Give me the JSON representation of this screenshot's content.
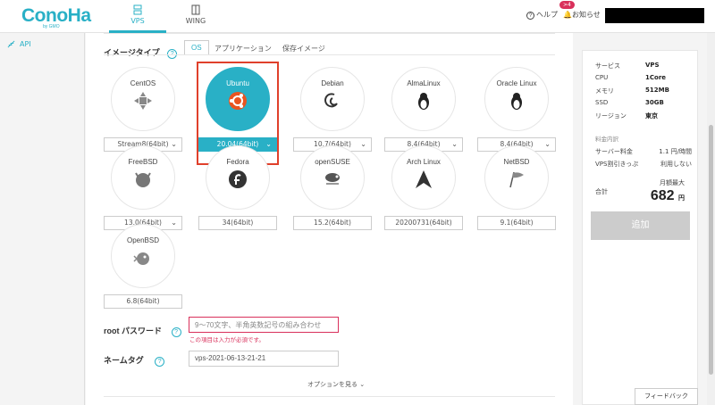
{
  "header": {
    "logo": "ConoHa",
    "logo_sub": "by GMO",
    "tabs": [
      {
        "label": "VPS"
      },
      {
        "label": "WING"
      }
    ],
    "help": "ヘルプ",
    "notice": "お知らせ",
    "notice_badge": ">4"
  },
  "sidebar": {
    "items": [
      {
        "label": "API"
      }
    ]
  },
  "main": {
    "image_type_label": "イメージタイプ",
    "subtabs": [
      {
        "label": "OS"
      },
      {
        "label": "アプリケーション"
      },
      {
        "label": "保存イメージ"
      }
    ],
    "os_list": [
      {
        "name": "CentOS",
        "version": "Stream8(64bit)",
        "has_dropdown": true
      },
      {
        "name": "Ubuntu",
        "version": "20.04(64bit)",
        "has_dropdown": true,
        "selected": true
      },
      {
        "name": "Debian",
        "version": "10.7(64bit)",
        "has_dropdown": true
      },
      {
        "name": "AlmaLinux",
        "version": "8.4(64bit)",
        "has_dropdown": true
      },
      {
        "name": "Oracle Linux",
        "version": "8.4(64bit)",
        "has_dropdown": true
      },
      {
        "name": "FreeBSD",
        "version": "13.0(64bit)",
        "has_dropdown": true
      },
      {
        "name": "Fedora",
        "version": "34(64bit)",
        "has_dropdown": false
      },
      {
        "name": "openSUSE",
        "version": "15.2(64bit)",
        "has_dropdown": false
      },
      {
        "name": "Arch Linux",
        "version": "20200731(64bit)",
        "has_dropdown": false
      },
      {
        "name": "NetBSD",
        "version": "9.1(64bit)",
        "has_dropdown": false
      },
      {
        "name": "OpenBSD",
        "version": "6.8(64bit)",
        "has_dropdown": false
      }
    ],
    "root_password_label": "root パスワード",
    "root_password_placeholder": "9～70文字、半角英数記号の組み合わせ",
    "root_password_error": "この項目は入力が必須です。",
    "name_tag_label": "ネームタグ",
    "name_tag_value": "vps-2021-06-13-21-21",
    "more_options": "オプションを見る"
  },
  "summary": {
    "specs": [
      {
        "k": "サービス",
        "v": "VPS"
      },
      {
        "k": "CPU",
        "v": "1Core"
      },
      {
        "k": "メモリ",
        "v": "512MB"
      },
      {
        "k": "SSD",
        "v": "30GB"
      },
      {
        "k": "リージョン",
        "v": "東京"
      }
    ],
    "fee_header": "料金内訳",
    "fees": [
      {
        "k": "サーバー料金",
        "v": "1.1 円/時間"
      },
      {
        "k": "VPS割引きっぷ",
        "v": "利用しない"
      }
    ],
    "total_label": "合計",
    "max_label": "月額最大",
    "price": "682",
    "price_unit": "円",
    "add_button": "追加"
  },
  "feedback": "フィードバック",
  "colors": {
    "accent": "#29b0c6",
    "error": "#d9305b",
    "highlight": "#e0402b"
  }
}
